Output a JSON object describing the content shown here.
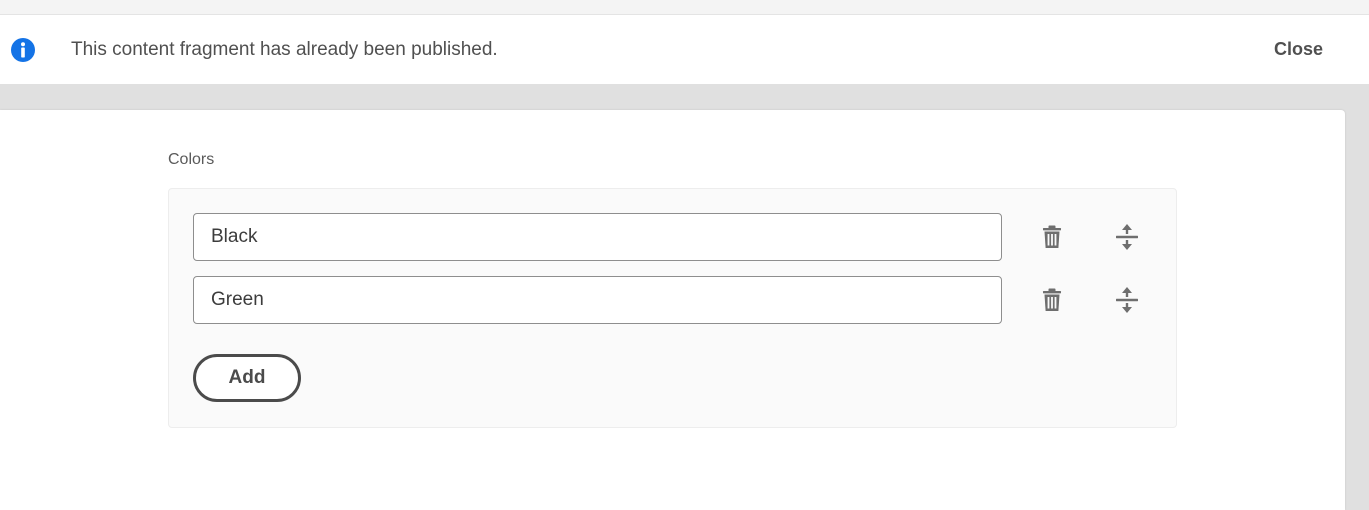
{
  "notification": {
    "icon": "info-icon",
    "message": "This content fragment has already been published.",
    "close_label": "Close",
    "icon_color": "#1473e6"
  },
  "field": {
    "label": "Colors",
    "items": [
      {
        "value": "Black",
        "delete_icon": "trash-icon",
        "reorder_icon": "drag-reorder-icon"
      },
      {
        "value": "Green",
        "delete_icon": "trash-icon",
        "reorder_icon": "drag-reorder-icon"
      }
    ],
    "add_label": "Add"
  }
}
